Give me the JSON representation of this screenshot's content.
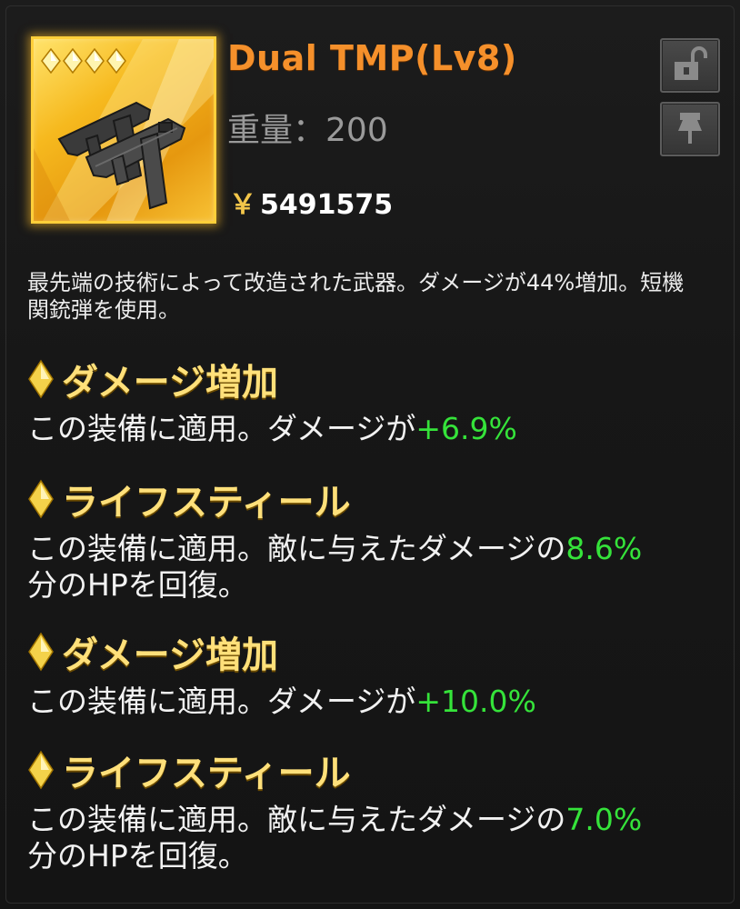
{
  "item": {
    "name": "Dual TMP(Lv8)",
    "weight_label": "重量：",
    "weight_value": "200",
    "currency_symbol": "￥",
    "price": "5491575",
    "rarity_stars": 4,
    "icon": "dual-smg-icon"
  },
  "controls": {
    "lock_icon": "unlock-icon",
    "pin_icon": "pin-icon"
  },
  "description": "最先端の技術によって改造された武器。ダメージが44%増加。短機関銃弾を使用。",
  "skills": [
    {
      "title": "ダメージ増加",
      "text_prefix": "この装備に適用。ダメージが",
      "value": "+6.9%",
      "text_suffix": ""
    },
    {
      "title": "ライフスティール",
      "text_prefix": "この装備に適用。敵に与えたダメージの",
      "value": "8.6%",
      "text_suffix": "分のHPを回復。"
    },
    {
      "title": "ダメージ増加",
      "text_prefix": "この装備に適用。ダメージが",
      "value": "+10.0%",
      "text_suffix": ""
    },
    {
      "title": "ライフスティール",
      "text_prefix": "この装備に適用。敵に与えたダメージの",
      "value": "7.0%",
      "text_suffix": "分のHPを回復。"
    }
  ],
  "colors": {
    "title": "#f5902b",
    "skill_title": "#ffe07a",
    "value_green": "#35e33a",
    "card_border": "#ffcf3a"
  }
}
